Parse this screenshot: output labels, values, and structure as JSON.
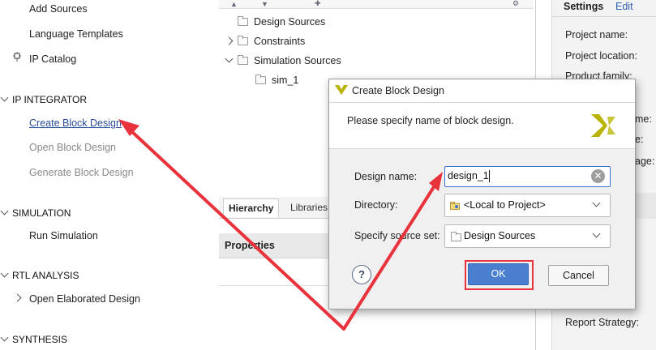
{
  "nav": {
    "add_sources": "Add Sources",
    "language_templates": "Language Templates",
    "ip_catalog": "IP Catalog",
    "ip_integrator": "IP INTEGRATOR",
    "create_block_design": "Create Block Design",
    "open_block_design": "Open Block Design",
    "generate_block_design": "Generate Block Design",
    "simulation": "SIMULATION",
    "run_simulation": "Run Simulation",
    "rtl_analysis": "RTL ANALYSIS",
    "open_elaborated_design": "Open Elaborated Design",
    "synthesis": "SYNTHESIS"
  },
  "sources": {
    "items": [
      "Design Sources",
      "Constraints",
      "Simulation Sources",
      "sim_1"
    ],
    "tabs": [
      "Hierarchy",
      "Libraries"
    ],
    "properties_title": "Properties"
  },
  "settings": {
    "tab_settings": "Settings",
    "tab_edit": "Edit",
    "project_name": "Project name:",
    "project_location": "Project location:",
    "product_family": "Product family:",
    "frag_1": "me:",
    "frag_2": "e:",
    "frag_3": "age:",
    "report_strategy": "Report Strategy:"
  },
  "dialog": {
    "title": "Create Block Design",
    "message": "Please specify name of block design.",
    "design_name_label": "Design name:",
    "design_name_value": "design_1",
    "directory_label": "Directory:",
    "directory_value": "<Local to Project>",
    "source_set_label": "Specify source set:",
    "source_set_value": "Design Sources",
    "ok_label": "OK",
    "cancel_label": "Cancel",
    "help_label": "?"
  },
  "colors": {
    "annotation_red": "#e8323c",
    "link_blue": "#2b4c9c",
    "ok_blue": "#4a7fd0",
    "xilinx_gold": "#b8b300"
  }
}
